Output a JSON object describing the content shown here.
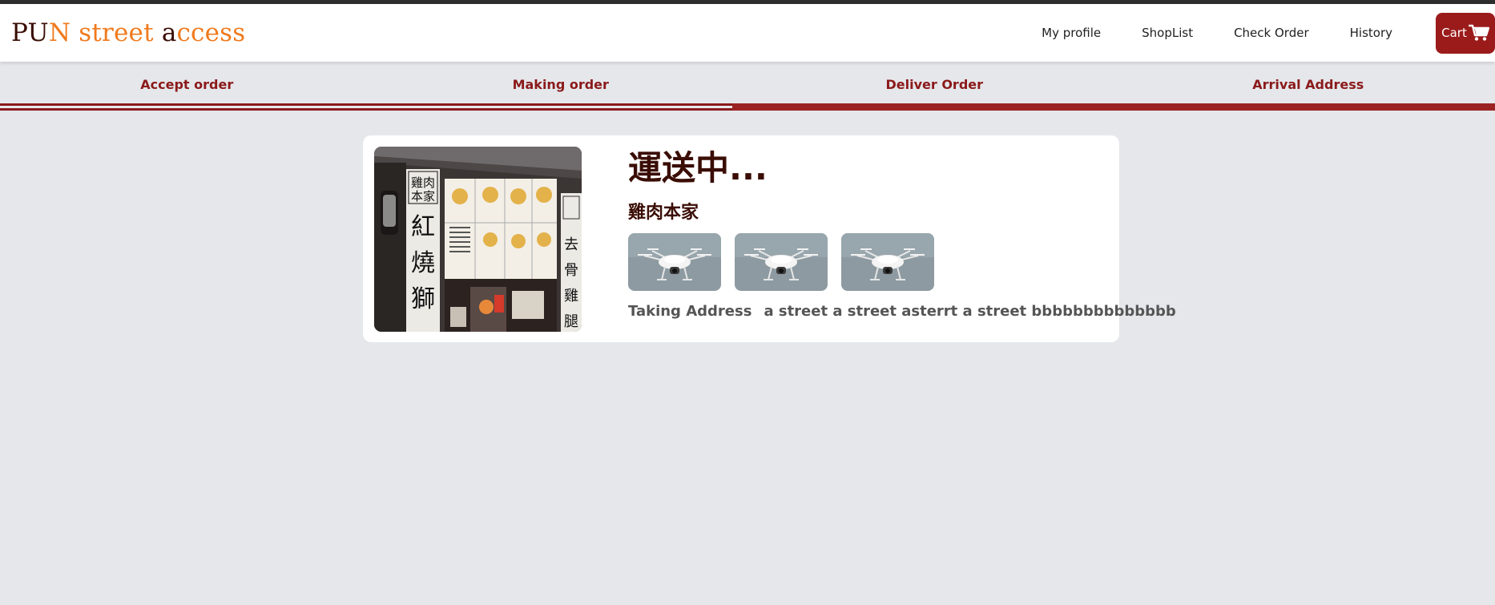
{
  "header": {
    "logo": {
      "parts": [
        "PU",
        "N street ",
        "a",
        "ccess"
      ]
    },
    "nav": [
      "My profile",
      "ShopList",
      "Check Order",
      "History"
    ],
    "cart_label": "Cart"
  },
  "steps": {
    "items": [
      "Accept order",
      "Making order",
      "Deliver Order",
      "Arrival Address"
    ],
    "progress": 0.51
  },
  "order": {
    "status": "運送中...",
    "shop_name": "雞肉本家",
    "shop_sign": [
      "雞肉",
      "本家",
      "紅",
      "燒",
      "獅",
      "去",
      "骨",
      "雞",
      "腿"
    ],
    "drone_count": 3,
    "address_label": "Taking Address",
    "address_value": "a street a street asterrt a street bbbbbbbbbbbbbb"
  },
  "colors": {
    "brand_dark": "#3a0d05",
    "brand_orange": "#f07a1d",
    "accent_red": "#9b1b1b",
    "step_text": "#8b1a1a",
    "page_bg": "#e5e7eb"
  }
}
